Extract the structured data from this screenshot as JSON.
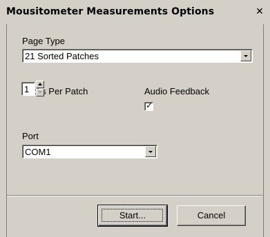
{
  "dialog": {
    "title": "Mousitometer Measurements Options",
    "close_glyph": "✕"
  },
  "page_type": {
    "label": "Page Type",
    "selected": "21 Sorted Patches"
  },
  "clicks_per_patch": {
    "label": "Clicks Per Patch",
    "value": "1"
  },
  "audio_feedback": {
    "label": "Audio Feedback",
    "checked": true,
    "check_glyph": "✓"
  },
  "port": {
    "label": "Port",
    "selected": "COM1"
  },
  "buttons": {
    "start_label": "Start...",
    "cancel_label": "Cancel"
  }
}
